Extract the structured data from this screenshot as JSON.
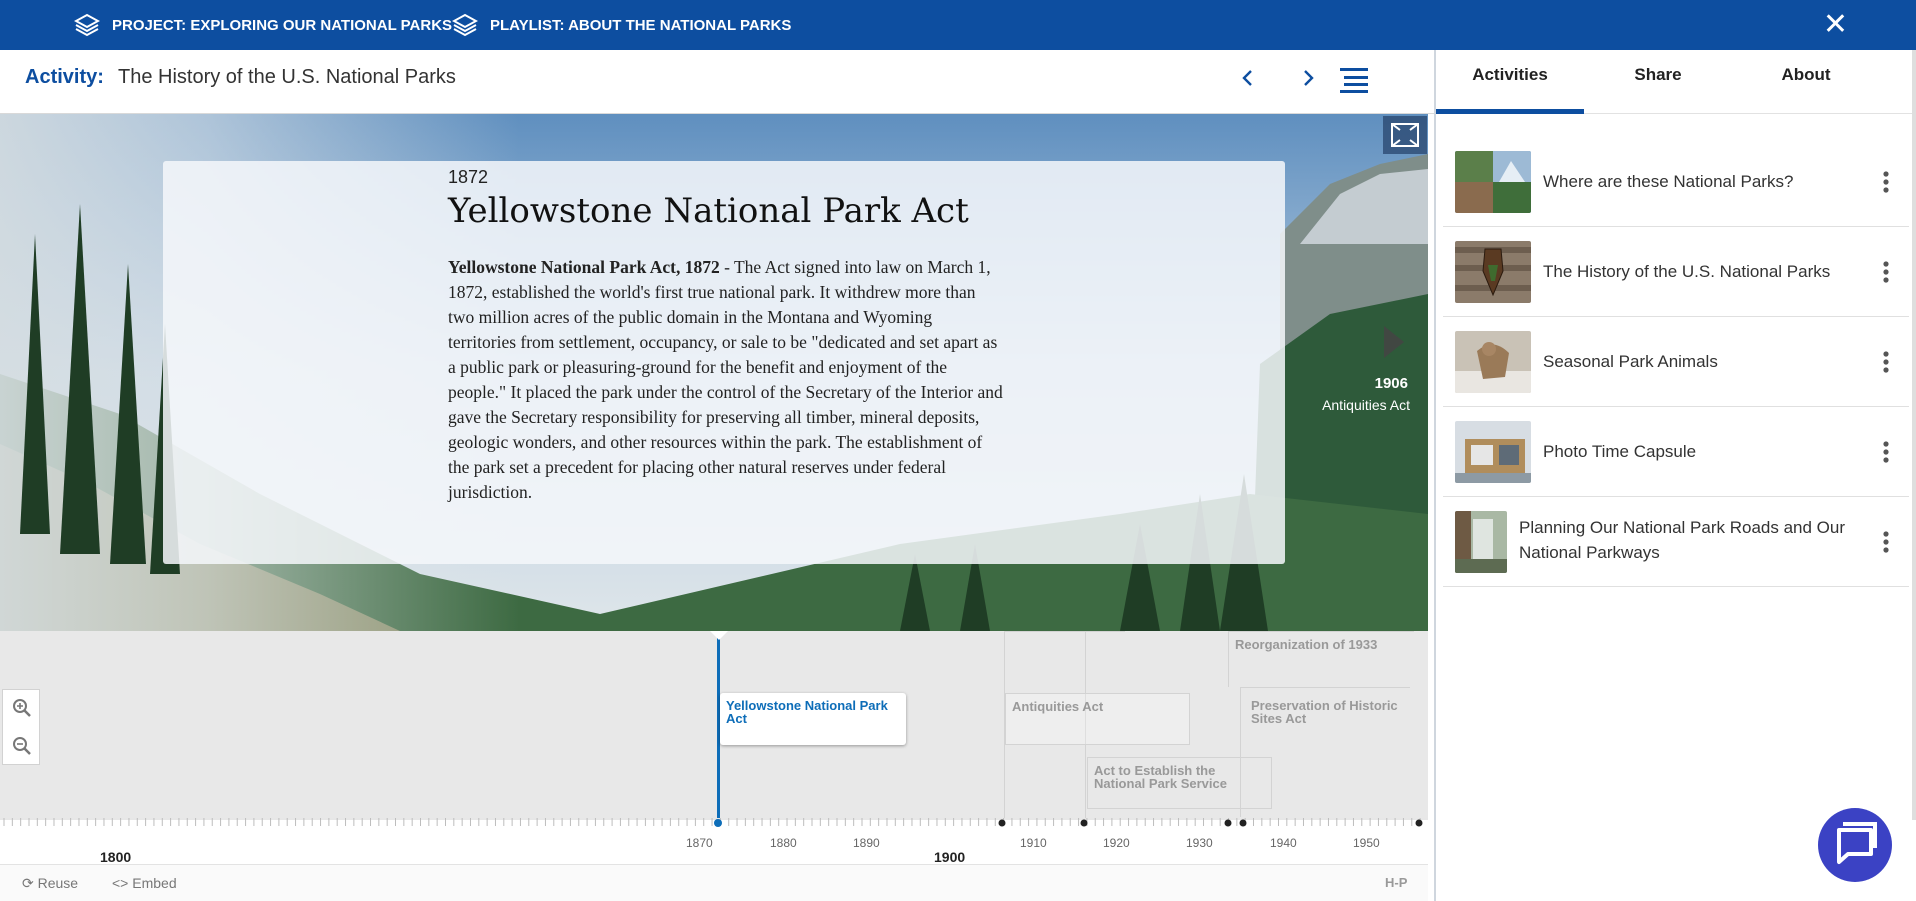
{
  "topbar": {
    "project_label": "PROJECT: EXPLORING OUR NATIONAL PARKS",
    "playlist_label": "PLAYLIST: ABOUT THE NATIONAL PARKS",
    "close_label": "✕"
  },
  "activity": {
    "label": "Activity:",
    "title": "The History of the U.S. National Parks"
  },
  "tabs": [
    "Activities",
    "Share",
    "About"
  ],
  "activities": [
    {
      "name": "Where are these National Parks?"
    },
    {
      "name": "The History of the U.S. National Parks"
    },
    {
      "name": "Seasonal Park Animals"
    },
    {
      "name": "Photo Time Capsule"
    },
    {
      "name": "Planning Our National Park Roads and Our National Parkways"
    }
  ],
  "slide": {
    "year": "1872",
    "heading": "Yellowstone National Park Act",
    "body_lead": "Yellowstone National Park Act, 1872",
    "body_text": " - The Act signed into law on March 1, 1872, established the world's first true national park. It withdrew more than two million acres of the public domain in the Montana and Wyoming territories from settlement, occupancy, or sale to be \"dedicated and set apart as a public park or pleasuring-ground for the benefit and enjoyment of the people.\" It placed the park under the control of the Secretary of the Interior and gave the Secretary responsibility for preserving all timber, mineral deposits, geologic wonders, and other resources within the park. The establishment of the park set a precedent for placing other natural reserves under federal jurisdiction.",
    "next_year": "1906",
    "next_label": "Antiquities Act"
  },
  "timeline": {
    "events": [
      {
        "label": "Reorganization of 1933"
      },
      {
        "label": "Yellowstone National Park Act"
      },
      {
        "label": "Antiquities Act"
      },
      {
        "label": "Preservation of Historic Sites Act"
      },
      {
        "label": "Act to Establish the National Park Service"
      }
    ],
    "tick_labels": [
      "1870",
      "1880",
      "1890",
      "1910",
      "1920",
      "1930",
      "1940",
      "1950"
    ],
    "major_labels": [
      "1800",
      "1900"
    ]
  },
  "footer": {
    "reuse": "Reuse",
    "embed": "Embed",
    "h5p": "H-P"
  },
  "colors": {
    "brand_blue": "#0d4ea0",
    "active_event": "#0d6db8",
    "chat_button": "#3b42c4"
  }
}
